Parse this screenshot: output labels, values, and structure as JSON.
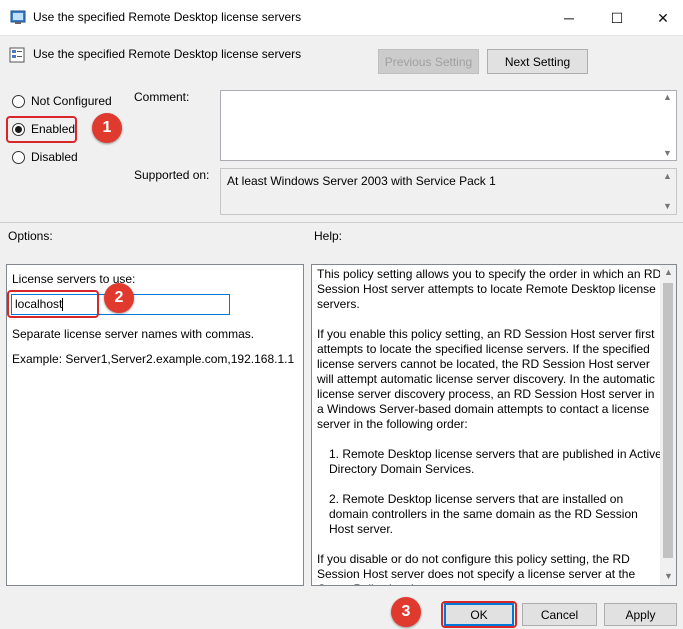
{
  "window": {
    "title": "Use the specified Remote Desktop license servers",
    "minimize_glyph": "─",
    "maximize_glyph": "☐",
    "close_glyph": "✕"
  },
  "header": {
    "policy_name": "Use the specified Remote Desktop license servers",
    "previous_label": "Previous Setting",
    "next_label": "Next Setting"
  },
  "state": {
    "not_configured_label": "Not Configured",
    "enabled_label": "Enabled",
    "disabled_label": "Disabled",
    "selected": "Enabled"
  },
  "comment": {
    "label": "Comment:",
    "value": ""
  },
  "supported": {
    "label": "Supported on:",
    "value": "At least Windows Server 2003 with Service Pack 1"
  },
  "options": {
    "label": "Options:",
    "servers_label": "License servers to use:",
    "servers_value": "localhost",
    "hint": "Separate license server names with commas.",
    "example": "Example: Server1,Server2.example.com,192.168.1.1"
  },
  "help": {
    "label": "Help:",
    "paragraphs": [
      "This policy setting allows you to specify the order in which an RD Session Host server attempts to locate Remote Desktop license servers.",
      "If you enable this policy setting, an RD Session Host server first attempts to locate the specified license servers. If the specified license servers cannot be located, the RD Session Host server will attempt automatic license server discovery. In the automatic license server discovery process, an RD Session Host server in a Windows Server-based domain attempts to contact a license server in the following order:",
      "1. Remote Desktop license servers that are published in Active Directory Domain Services.",
      "2. Remote Desktop license servers that are installed on domain controllers in the same domain as the RD Session Host server.",
      "If you disable or do not configure this policy setting, the RD Session Host server does not specify a license server at the Group Policy level."
    ]
  },
  "footer": {
    "ok_label": "OK",
    "cancel_label": "Cancel",
    "apply_label": "Apply"
  },
  "callouts": [
    "1",
    "2",
    "3"
  ],
  "colors": {
    "callout": "#e03a2f",
    "highlight": "#d9262a",
    "ok_focus": "#0078d7"
  }
}
